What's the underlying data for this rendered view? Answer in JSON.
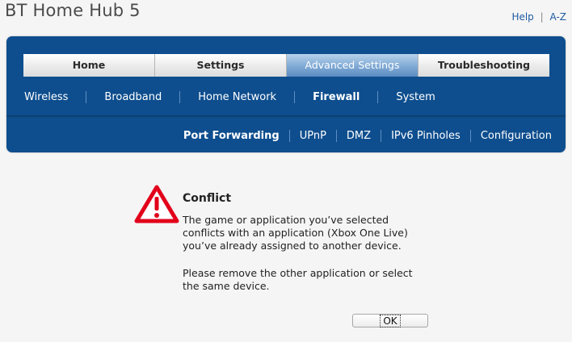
{
  "app": {
    "title": "BT Home Hub 5"
  },
  "top_links": {
    "help": "Help",
    "separator": "|",
    "az": "A-Z"
  },
  "main_tabs": [
    {
      "label": "Home"
    },
    {
      "label": "Settings"
    },
    {
      "label": "Advanced Settings",
      "active": true
    },
    {
      "label": "Troubleshooting"
    }
  ],
  "sub_nav": [
    {
      "label": "Wireless"
    },
    {
      "label": "Broadband"
    },
    {
      "label": "Home Network"
    },
    {
      "label": "Firewall",
      "active": true
    },
    {
      "label": "System"
    }
  ],
  "third_nav": [
    {
      "label": "Port Forwarding",
      "active": true
    },
    {
      "label": "UPnP"
    },
    {
      "label": "DMZ"
    },
    {
      "label": "IPv6 Pinholes"
    },
    {
      "label": "Configuration"
    }
  ],
  "dialog": {
    "icon": "warning-triangle-icon",
    "title": "Conflict",
    "message": "The game or application you’ve selected conflicts with an application (Xbox One Live) you’ve already assigned to another device.",
    "instruction": "Please remove the other application or select the same device.",
    "ok_label": "OK"
  },
  "colors": {
    "header_blue": "#0e4e8e",
    "active_tab": "#7fa9d4",
    "warning_red": "#e2001a",
    "link_blue": "#1f5aa0"
  }
}
